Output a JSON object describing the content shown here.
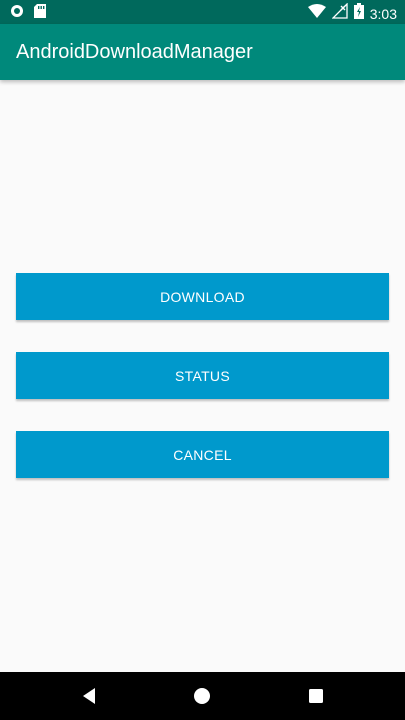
{
  "status_bar": {
    "time": "3:03",
    "icons": [
      "record-icon",
      "sd-card-icon",
      "wifi-icon",
      "no-signal-icon",
      "battery-charging-icon"
    ]
  },
  "app_bar": {
    "title": "AndroidDownloadManager"
  },
  "buttons": {
    "download": "DOWNLOAD",
    "status": "STATUS",
    "cancel": "CANCEL"
  },
  "nav_bar": {
    "icons": [
      "back-icon",
      "home-icon",
      "recents-icon"
    ]
  },
  "colors": {
    "status_bar": "#00695c",
    "app_bar": "#00897b",
    "button": "#0099cc",
    "background": "#fafafa"
  }
}
